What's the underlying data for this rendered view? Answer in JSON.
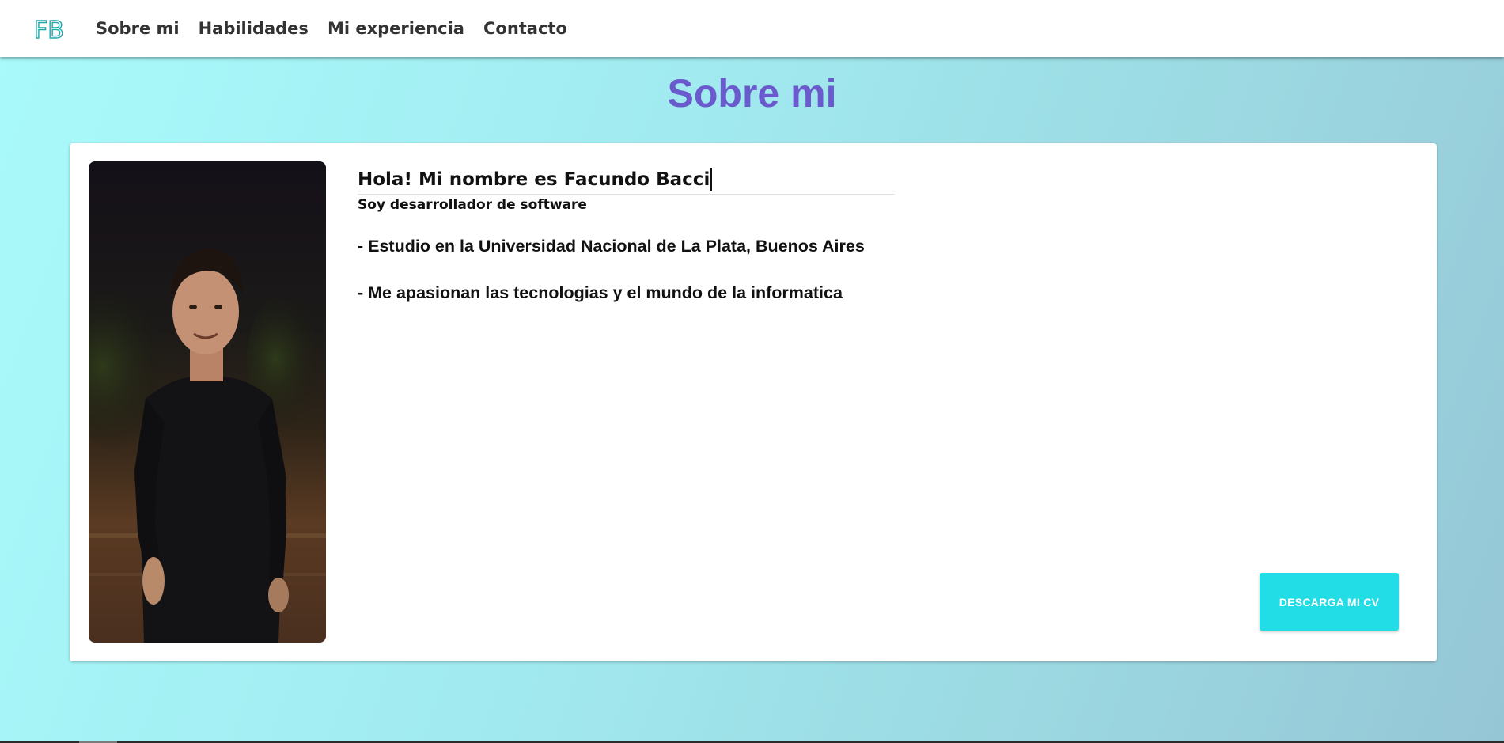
{
  "navbar": {
    "logo_text": "FB",
    "links": [
      "Sobre mi",
      "Habilidades",
      "Mi experiencia",
      "Contacto"
    ]
  },
  "section": {
    "title": "Sobre mi"
  },
  "about": {
    "greeting": "Hola! Mi nombre es Facundo Bacci",
    "subtitle": "Soy desarrollador de software",
    "bullets": [
      "- Estudio en la Universidad Nacional de La Plata, Buenos Aires",
      "- Me apasionan las tecnologias y el mundo de la informatica"
    ],
    "cv_button": "DESCARGA MI CV"
  },
  "colors": {
    "title": "#6a5acd",
    "button": "#22dde6",
    "logo": "#1fa9a9",
    "background_start": "#a9fafb",
    "background_end": "#95c6d6"
  }
}
